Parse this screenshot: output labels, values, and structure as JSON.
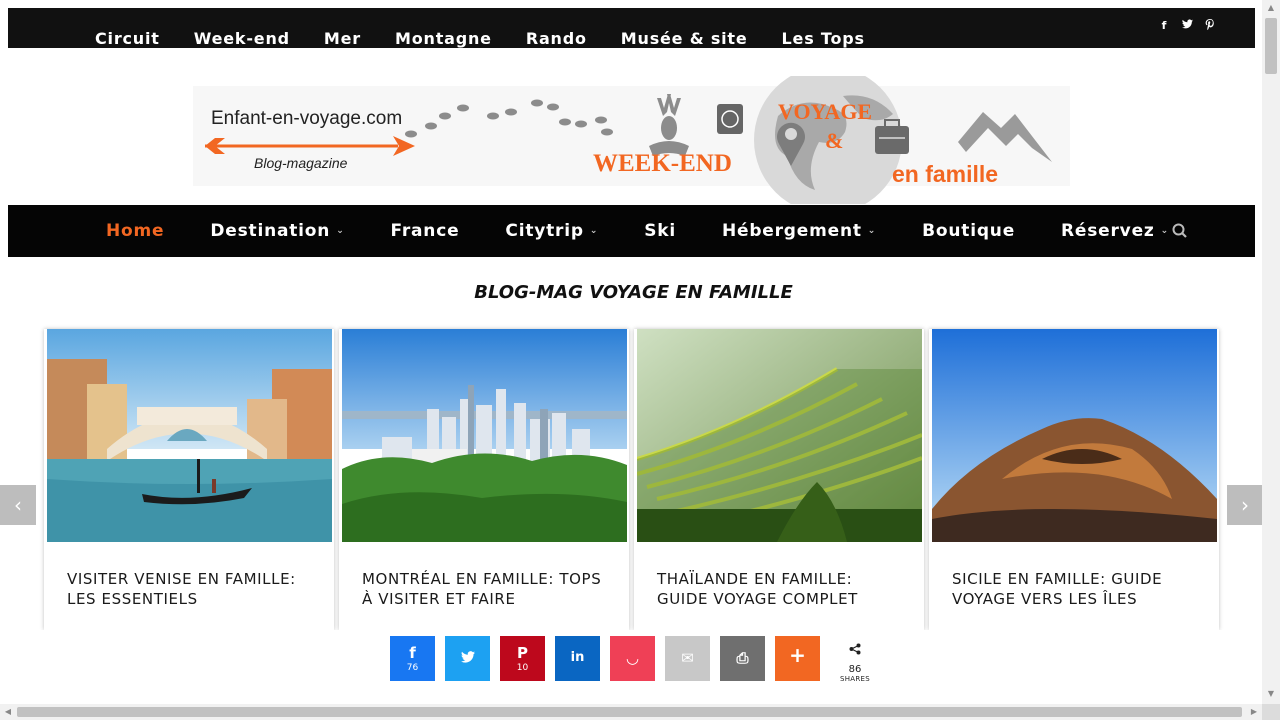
{
  "top_nav": [
    "Circuit",
    "Week-end",
    "Mer",
    "Montagne",
    "Rando",
    "Musée & site",
    "Les Tops"
  ],
  "social_icons": [
    "facebook-icon",
    "twitter-icon",
    "pinterest-icon"
  ],
  "logo": {
    "site": "Enfant-en-voyage.com",
    "tagline": "Blog-magazine",
    "word_weekend": "WEEK-END",
    "word_voyage": "VOYAGE",
    "word_amp": "&",
    "word_famille": "en famille",
    "accent": "#f26722"
  },
  "main_nav": {
    "home": "Home",
    "destination": "Destination",
    "france": "France",
    "citytrip": "Citytrip",
    "ski": "Ski",
    "hebergement": "Hébergement",
    "boutique": "Boutique",
    "reservez": "Réservez",
    "caret": "⌄",
    "active_color": "#f26722"
  },
  "section_title": "BLOG-MAG VOYAGE EN FAMILLE",
  "carousel": {
    "prev": "‹",
    "next": "›",
    "cards": [
      {
        "title": "VISITER VENISE EN FAMILLE: LES ESSENTIELS"
      },
      {
        "title": "MONTRÉAL EN FAMILLE: TOPS À VISITER ET FAIRE"
      },
      {
        "title": "THAÏLANDE EN FAMILLE: GUIDE VOYAGE COMPLET"
      },
      {
        "title": "SICILE EN FAMILLE: GUIDE VOYAGE VERS LES ÎLES"
      }
    ]
  },
  "share": {
    "facebook": {
      "icon": "f",
      "count": "76",
      "color": "#1877f2"
    },
    "twitter": {
      "icon": "🐦",
      "color": "#1da1f2"
    },
    "pinterest": {
      "icon": "P",
      "count": "10",
      "color": "#bd081c"
    },
    "linkedin": {
      "icon": "in",
      "color": "#0a66c2"
    },
    "pocket": {
      "icon": "◡",
      "color": "#ef4056"
    },
    "email": {
      "icon": "✉",
      "color": "#c8c8c8"
    },
    "print": {
      "icon": "⎙",
      "color": "#6f6f6f"
    },
    "more": {
      "icon": "+",
      "color": "#f26722"
    },
    "total": "86",
    "total_label": "SHARES"
  }
}
